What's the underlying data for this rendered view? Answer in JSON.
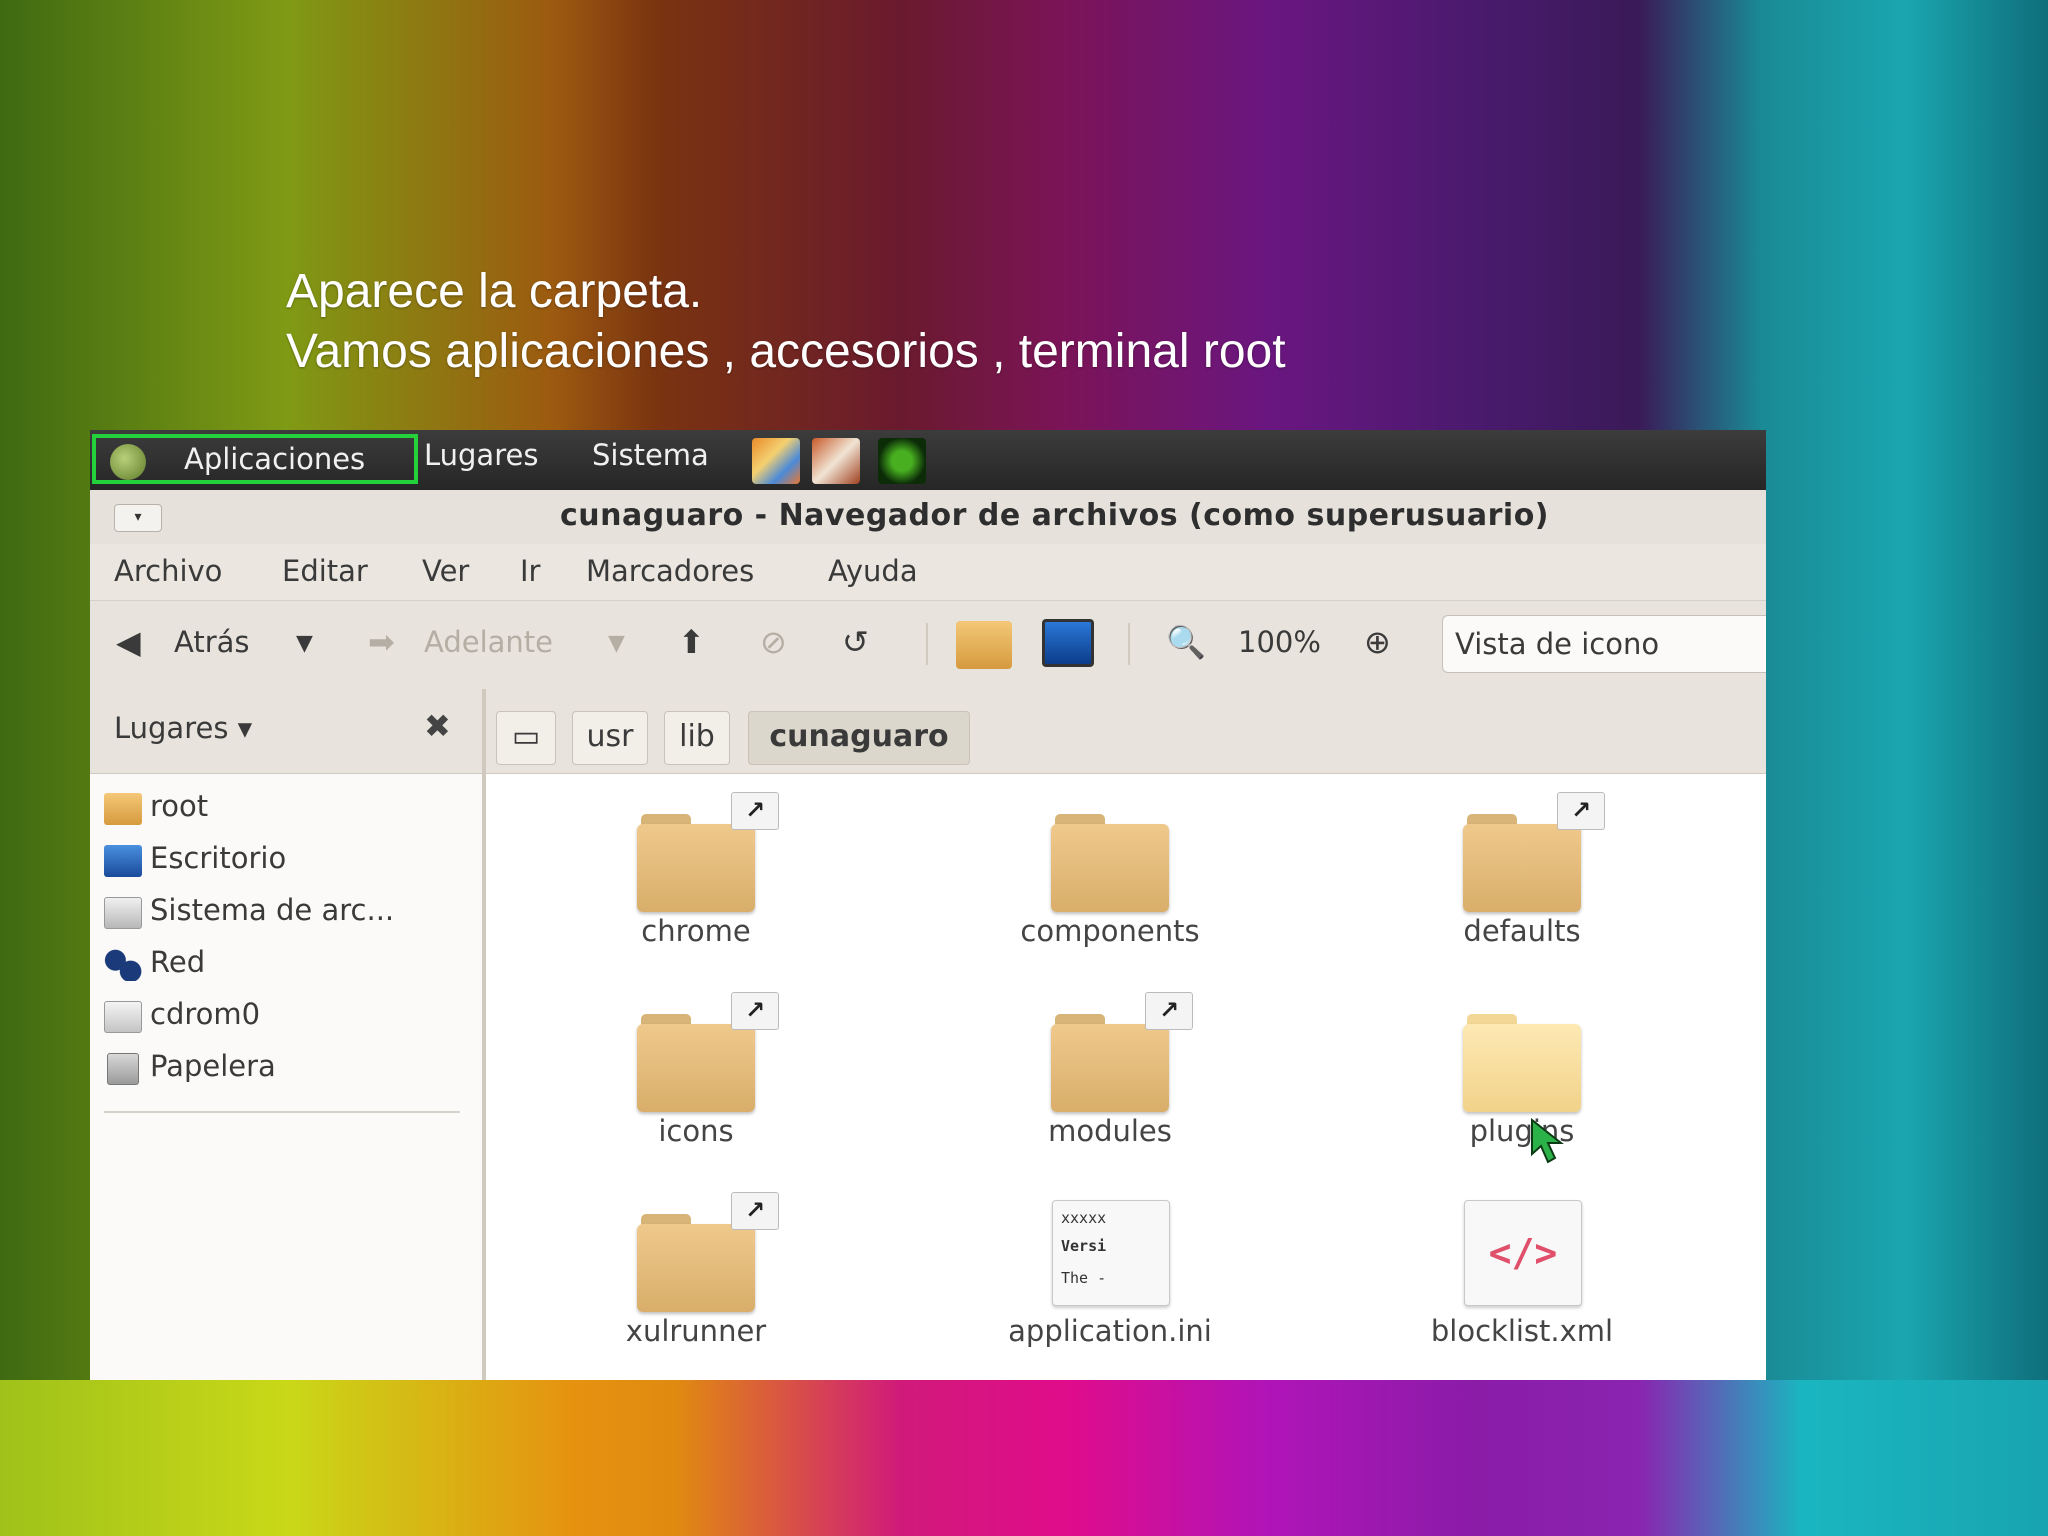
{
  "caption": {
    "line1": "Aparece la carpeta.",
    "line2": "Vamos aplicaciones , accesorios , terminal root"
  },
  "panel": {
    "applications": "Aplicaciones",
    "places": "Lugares",
    "system": "Sistema"
  },
  "window": {
    "title": "cunaguaro - Navegador de archivos (como superusuario)",
    "menu": [
      "Archivo",
      "Editar",
      "Ver",
      "Ir",
      "Marcadores",
      "Ayuda"
    ],
    "toolbar": {
      "back": "Atrás",
      "forward": "Adelante",
      "zoom": "100%",
      "view_mode": "Vista de icono"
    },
    "sidebar": {
      "header": "Lugares",
      "items": [
        "root",
        "Escritorio",
        "Sistema de arc...",
        "Red",
        "cdrom0",
        "Papelera"
      ]
    },
    "path": [
      "usr",
      "lib",
      "cunaguaro"
    ],
    "files": [
      {
        "name": "chrome",
        "kind": "folder-link"
      },
      {
        "name": "components",
        "kind": "folder"
      },
      {
        "name": "defaults",
        "kind": "folder-link"
      },
      {
        "name": "icons",
        "kind": "folder-link"
      },
      {
        "name": "modules",
        "kind": "folder-link"
      },
      {
        "name": "plugins",
        "kind": "folder-selected"
      },
      {
        "name": "xulrunner",
        "kind": "folder-link"
      },
      {
        "name": "application.ini",
        "kind": "text-file"
      },
      {
        "name": "blocklist.xml",
        "kind": "xml-file"
      }
    ],
    "doc_preview": [
      "xxxxx",
      "Versi",
      "The -"
    ]
  },
  "colors": {
    "highlight_border": "#23d23a",
    "folder": "#e2bb78"
  }
}
